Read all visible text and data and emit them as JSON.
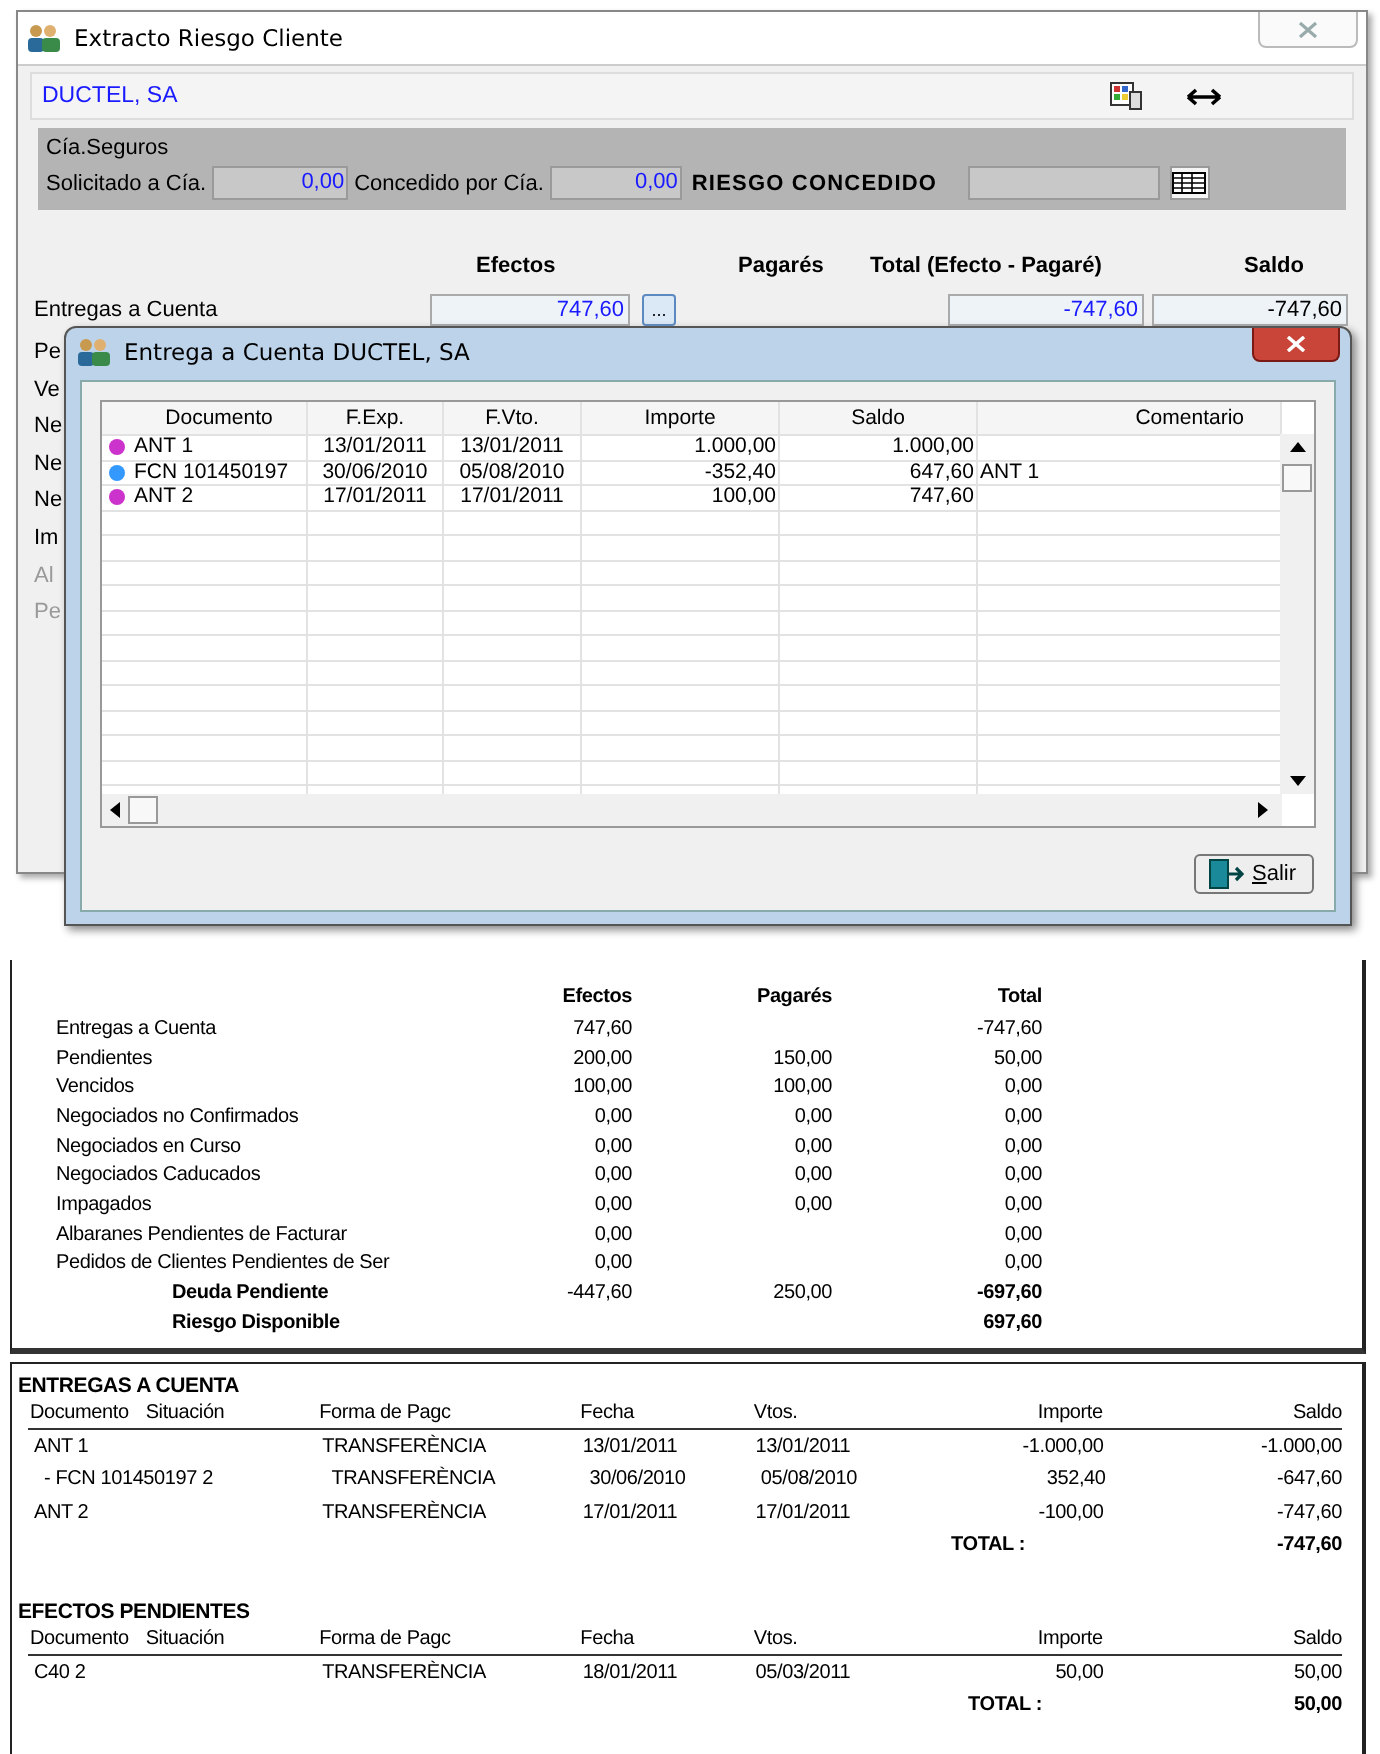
{
  "main_window": {
    "title": "Extracto Riesgo Cliente",
    "customer": "DUCTEL, SA",
    "insurance": {
      "title": "Cía.Seguros",
      "requested_label": "Solicitado a Cía.",
      "requested": "0,00",
      "granted_label": "Concedido por Cía.",
      "granted": "0,00",
      "risk_label": "RIESGO CONCEDIDO"
    },
    "columns": [
      "Efectos",
      "Pagarés",
      "Total (Efecto - Pagaré)",
      "Saldo"
    ],
    "first_row": {
      "label": "Entregas a Cuenta",
      "efectos": "747,60",
      "button": "...",
      "total": "-747,60",
      "saldo": "-747,60"
    },
    "partial_labels": [
      {
        "text": "Pe",
        "disabled": false
      },
      {
        "text": "Ve",
        "disabled": false
      },
      {
        "text": "Ne",
        "disabled": false
      },
      {
        "text": "Ne",
        "disabled": false
      },
      {
        "text": "Ne",
        "disabled": false
      },
      {
        "text": "Im",
        "disabled": false
      },
      {
        "text": "Al",
        "disabled": true
      },
      {
        "text": "Pe",
        "disabled": true
      }
    ]
  },
  "dialog": {
    "title": "Entrega a Cuenta DUCTEL, SA",
    "columns": [
      "Documento",
      "F.Exp.",
      "F.Vto.",
      "Importe",
      "Saldo",
      "Comentario"
    ],
    "rows": [
      {
        "color": "#cc33cc",
        "documento": "ANT 1",
        "f_exp": "13/01/2011",
        "f_vto": "13/01/2011",
        "importe": "1.000,00",
        "saldo": "1.000,00"
      },
      {
        "color": "#3399ff",
        "documento": "FCN 101450197",
        "f_exp": "30/06/2010",
        "f_vto": "05/08/2010",
        "importe": "-352,40",
        "saldo": "647,60",
        "comentario": "ANT 1"
      },
      {
        "color": "#cc33cc",
        "documento": "ANT 2",
        "f_exp": "17/01/2011",
        "f_vto": "17/01/2011",
        "importe": "100,00",
        "saldo": "747,60"
      }
    ],
    "button": "Salir"
  },
  "report": {
    "summary": {
      "columns": [
        "Efectos",
        "Pagarés",
        "Total"
      ],
      "rows": [
        {
          "kind": "line",
          "label": "Entregas a Cuenta",
          "efectos": "747,60",
          "total": "-747,60"
        },
        {
          "kind": "line",
          "label": "Pendientes",
          "efectos": "200,00",
          "pagares": "150,00",
          "total": "50,00"
        },
        {
          "kind": "line",
          "label": "Vencidos",
          "efectos": "100,00",
          "pagares": "100,00",
          "total": "0,00"
        },
        {
          "kind": "line",
          "label": "Negociados no Confirmados",
          "efectos": "0,00",
          "pagares": "0,00",
          "total": "0,00"
        },
        {
          "kind": "line",
          "label": "Negociados en Curso",
          "efectos": "0,00",
          "pagares": "0,00",
          "total": "0,00"
        },
        {
          "kind": "line",
          "label": "Negociados Caducados",
          "efectos": "0,00",
          "pagares": "0,00",
          "total": "0,00"
        },
        {
          "kind": "line",
          "label": "Impagados",
          "efectos": "0,00",
          "pagares": "0,00",
          "total": "0,00"
        },
        {
          "kind": "line",
          "label": "Albaranes Pendientes de Facturar",
          "efectos": "0,00",
          "total": "0,00"
        },
        {
          "kind": "line",
          "label": "Pedidos de Clientes Pendientes de Ser",
          "efectos": "0,00",
          "total": "0,00"
        },
        {
          "kind": "total",
          "label": "Deuda Pendiente",
          "efectos": "-447,60",
          "pagares": "250,00",
          "total": "-697,60"
        },
        {
          "kind": "total",
          "label": "Riesgo Disponible",
          "total": "697,60"
        }
      ]
    },
    "sections": [
      {
        "title": "ENTREGAS A CUENTA",
        "columns": [
          "Documento",
          "Situación",
          "Forma de Pagc",
          "Fecha",
          "Vtos.",
          "Importe",
          "Saldo"
        ],
        "rows": [
          {
            "documento": "ANT 1",
            "forma": "TRANSFERÈNCIA",
            "fecha": "13/01/2011",
            "vto": "13/01/2011",
            "importe": "-1.000,00",
            "saldo": "-1.000,00",
            "children": [
              {
                "documento": "- FCN 101450197 2",
                "forma": "TRANSFERÈNCIA",
                "fecha": "30/06/2010",
                "vto": "05/08/2010",
                "importe": "352,40",
                "saldo": "-647,60"
              }
            ]
          },
          {
            "documento": "ANT 2",
            "forma": "TRANSFERÈNCIA",
            "fecha": "17/01/2011",
            "vto": "17/01/2011",
            "importe": "-100,00",
            "saldo": "-747,60"
          }
        ],
        "total_label": "TOTAL :",
        "total": "-747,60"
      },
      {
        "title": "EFECTOS PENDIENTES",
        "columns": [
          "Documento",
          "Situación",
          "Forma de Pagc",
          "Fecha",
          "Vtos.",
          "Importe",
          "Saldo"
        ],
        "rows": [
          {
            "documento": "C40 2",
            "forma": "TRANSFERÈNCIA",
            "fecha": "18/01/2011",
            "vto": "05/03/2011",
            "importe": "50,00",
            "saldo": "50,00"
          }
        ],
        "total_label": "TOTAL :",
        "total": "50,00"
      }
    ]
  }
}
